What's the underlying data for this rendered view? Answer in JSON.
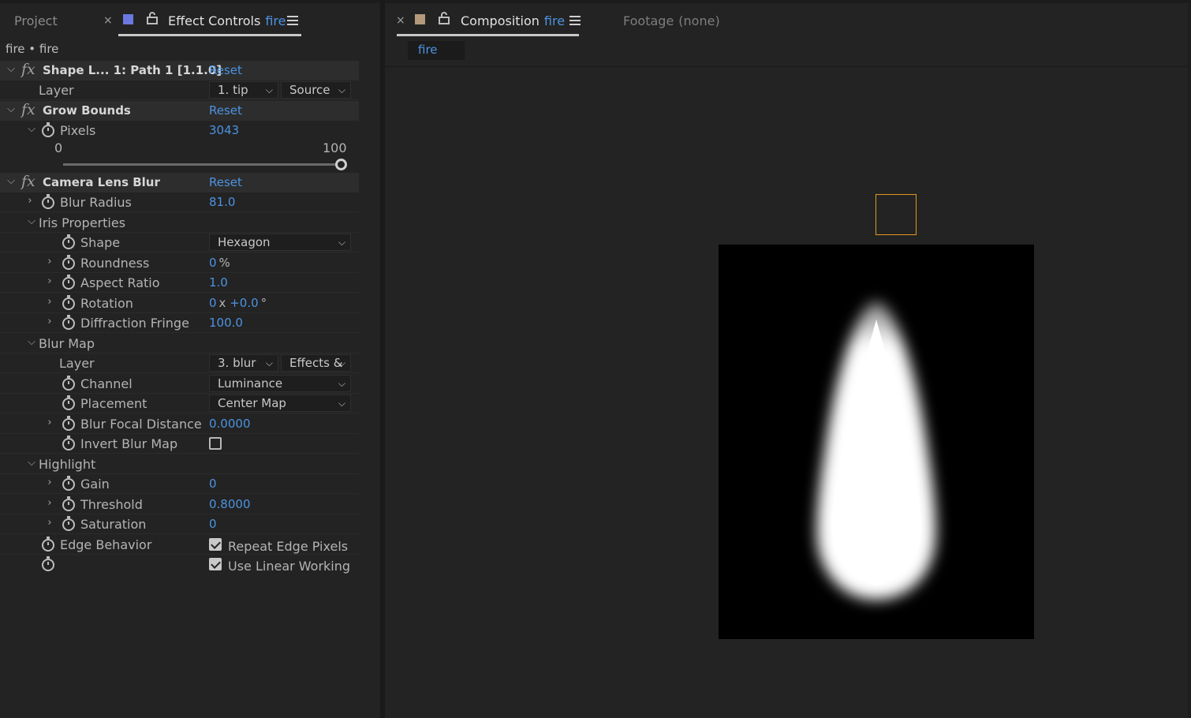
{
  "left_panel": {
    "tabs": {
      "project": "Project",
      "effect_controls": "Effect Controls",
      "effect_controls_layer": "fire",
      "label_color": "#6a78e0"
    },
    "breadcrumb": "fire • fire",
    "effects": {
      "shape_layer": {
        "name": "Shape L... 1: Path 1 [1.1.0]",
        "reset": "Reset",
        "layer_label": "Layer",
        "layer_value": "1. tip",
        "layer_source": "Source"
      },
      "grow_bounds": {
        "name": "Grow Bounds",
        "reset": "Reset",
        "pixels_label": "Pixels",
        "pixels_value": "3043",
        "slider_min": "0",
        "slider_max": "100",
        "slider_value": 100
      },
      "camera_lens_blur": {
        "name": "Camera Lens Blur",
        "reset": "Reset",
        "blur_radius_label": "Blur Radius",
        "blur_radius_value": "81.0",
        "iris_properties_label": "Iris Properties",
        "shape_label": "Shape",
        "shape_value": "Hexagon",
        "roundness_label": "Roundness",
        "roundness_value": "0",
        "roundness_unit": "%",
        "aspect_ratio_label": "Aspect Ratio",
        "aspect_ratio_value": "1.0",
        "rotation_label": "Rotation",
        "rotation_revolutions": "0",
        "rotation_x": "x",
        "rotation_degrees": "+0.0",
        "rotation_unit": "°",
        "diffraction_fringe_label": "Diffraction Fringe",
        "diffraction_fringe_value": "100.0",
        "blur_map_label": "Blur Map",
        "blur_map_layer_label": "Layer",
        "blur_map_layer_value": "3. blur",
        "blur_map_layer_source": "Effects &",
        "channel_label": "Channel",
        "channel_value": "Luminance",
        "placement_label": "Placement",
        "placement_value": "Center Map",
        "blur_focal_distance_label": "Blur Focal Distance",
        "blur_focal_distance_value": "0.0000",
        "invert_blur_map_label": "Invert Blur Map",
        "invert_blur_map_checked": false,
        "highlight_label": "Highlight",
        "gain_label": "Gain",
        "gain_value": "0",
        "threshold_label": "Threshold",
        "threshold_value": "0.8000",
        "saturation_label": "Saturation",
        "saturation_value": "0",
        "edge_behavior_label": "Edge Behavior",
        "repeat_edge_pixels_label": "Repeat Edge Pixels",
        "repeat_edge_pixels_checked": true,
        "use_linear_working_label": "Use Linear Working",
        "use_linear_working_checked": true
      }
    }
  },
  "right_panel": {
    "tabs": {
      "composition": "Composition",
      "composition_name": "fire",
      "label_color": "#b39a7c",
      "footage": "Footage",
      "footage_value": "(none)"
    },
    "subtab": "fire",
    "selection_color": "#e0981f"
  },
  "colors": {
    "accent_blue": "#4c93e2",
    "background": "#232323"
  }
}
